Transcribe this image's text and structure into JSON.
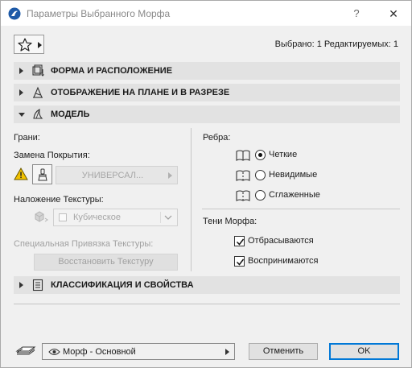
{
  "window": {
    "title": "Параметры Выбранного Морфа",
    "help_label": "?",
    "close_label": "✕"
  },
  "header": {
    "favorites_icon": "star-icon",
    "selected_info": "Выбрано: 1 Редактируемых: 1"
  },
  "sections": {
    "shape": {
      "label": "ФОРМА И РАСПОЛОЖЕНИЕ",
      "expanded": false
    },
    "plan": {
      "label": "ОТОБРАЖЕНИЕ НА ПЛАНЕ И В РАЗРЕЗЕ",
      "expanded": false
    },
    "model": {
      "label": "МОДЕЛЬ",
      "expanded": true
    },
    "classification": {
      "label": "КЛАССИФИКАЦИЯ И СВОЙСТВА",
      "expanded": false
    }
  },
  "model": {
    "faces_label": "Грани:",
    "override_label": "Замена Покрытия:",
    "override_value": "УНИВЕРСАЛ...",
    "texture_label": "Наложение Текстуры:",
    "texture_value": "Кубическое",
    "special_texture_label": "Специальная Привязка Текстуры:",
    "restore_texture_button": "Восстановить Текстуру",
    "edges_label": "Ребра:",
    "edges_options": [
      {
        "label": "Четкие",
        "checked": true
      },
      {
        "label": "Невидимые",
        "checked": false
      },
      {
        "label": "Сглаженные",
        "checked": false
      }
    ],
    "shadows_label": "Тени Морфа:",
    "shadow_options": [
      {
        "label": "Отбрасываются",
        "checked": true
      },
      {
        "label": "Воспринимаются",
        "checked": true
      }
    ]
  },
  "footer": {
    "layer_value": "Морф - Основной",
    "cancel_label": "Отменить",
    "ok_label": "OK"
  },
  "colors": {
    "dialog_bg": "#f0f0f0",
    "section_bg": "#e2e2e2",
    "ok_border": "#0078d7",
    "warning": "#f2c200",
    "disabled_text": "#a0a0a0"
  }
}
